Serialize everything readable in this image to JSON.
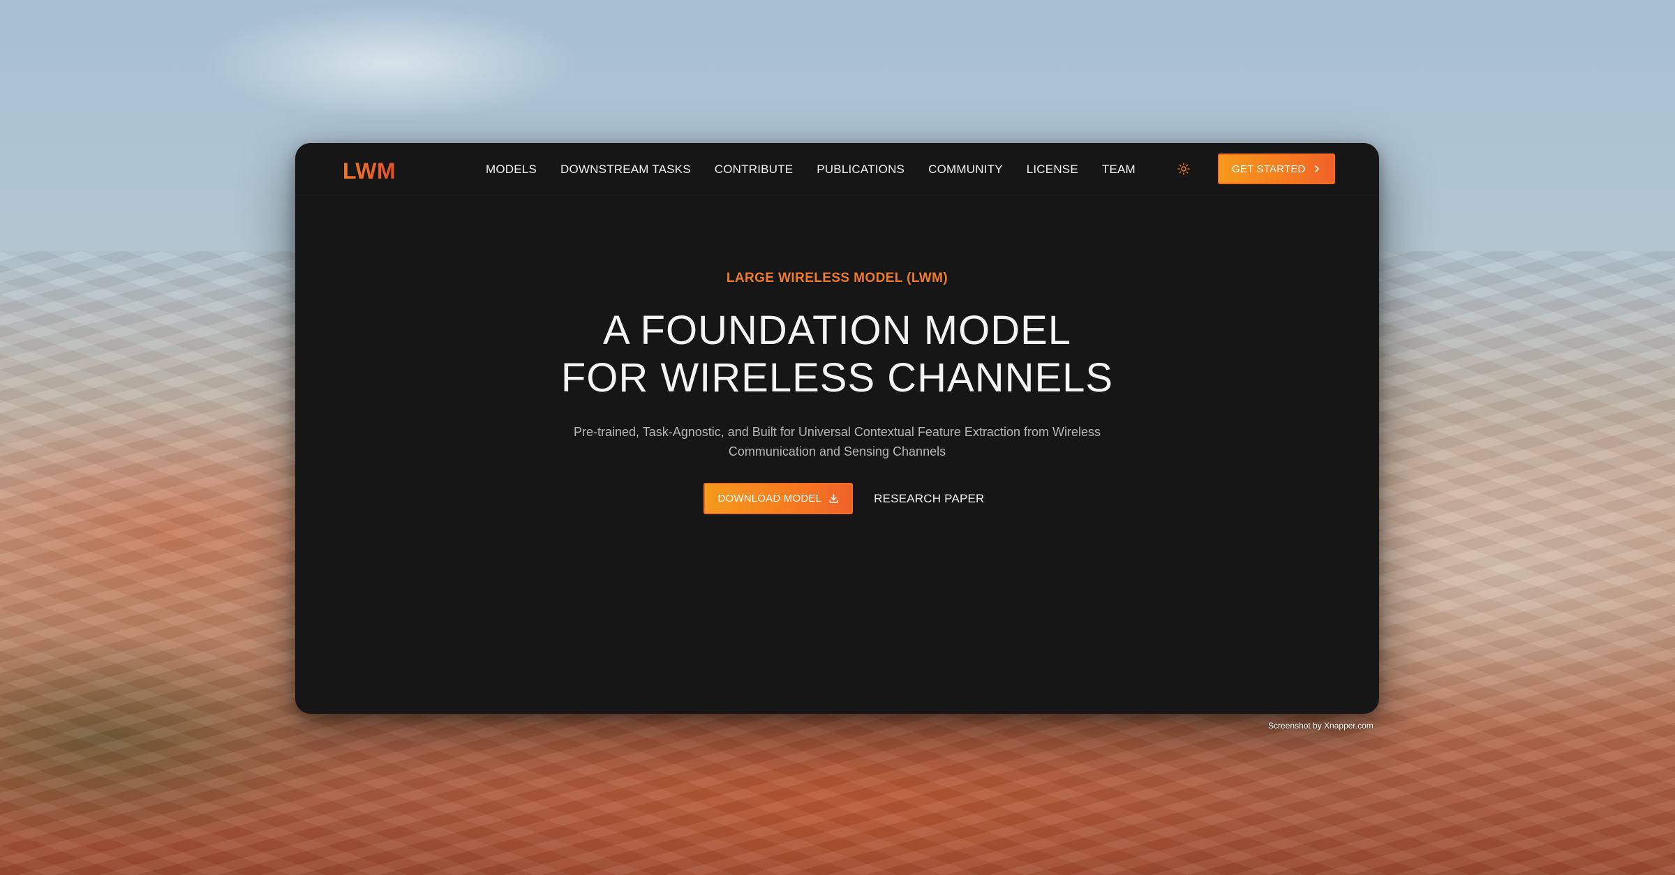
{
  "header": {
    "logo": "LWM",
    "nav": [
      "MODELS",
      "DOWNSTREAM TASKS",
      "CONTRIBUTE",
      "PUBLICATIONS",
      "COMMUNITY",
      "LICENSE",
      "TEAM"
    ],
    "theme_icon": "sun-icon",
    "cta_label": "GET STARTED",
    "cta_icon": "chevron-right-icon"
  },
  "hero": {
    "eyebrow": "LARGE WIRELESS MODEL (LWM)",
    "headline_line1": "A FOUNDATION MODEL",
    "headline_line2": "FOR WIRELESS CHANNELS",
    "subtitle_line1": "Pre-trained, Task-Agnostic, and Built for Universal Contextual Feature Extraction from Wireless",
    "subtitle_line2": "Communication and Sensing Channels",
    "primary_button": "DOWNLOAD MODEL",
    "primary_icon": "download-icon",
    "secondary_link": "RESEARCH PAPER"
  },
  "footer": {
    "credit": "Screenshot by Xnapper.com"
  },
  "colors": {
    "accent": "#f57a1f",
    "window_bg": "#161617"
  }
}
